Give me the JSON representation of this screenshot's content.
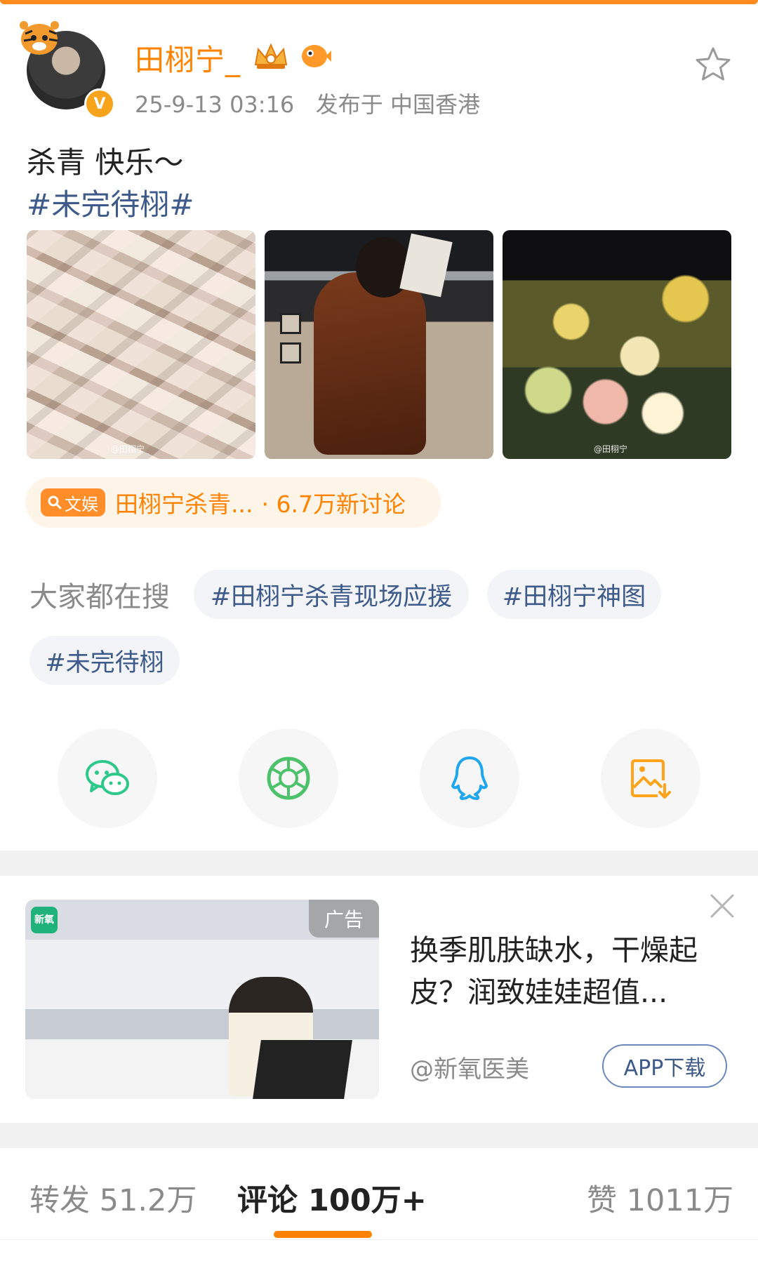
{
  "post": {
    "username": "田栩宁_",
    "timestamp": "25-9-13 03:16",
    "location": "发布于 中国香港",
    "text": "杀青  快乐～",
    "hashtag": "#未完待栩#",
    "photo_watermark_1": "@田栩宁_",
    "photo_watermark_3": "@田栩宁"
  },
  "topic": {
    "badge": "文娱",
    "title": "田栩宁杀青...",
    "count": "· 6.7万新讨论"
  },
  "search": {
    "label": "大家都在搜",
    "chips": [
      "#田栩宁杀青现场应援",
      "#田栩宁神图",
      "#未完待栩"
    ]
  },
  "share": {
    "icons": [
      "wechat-icon",
      "moments-icon",
      "qq-icon",
      "save-image-icon"
    ]
  },
  "ad": {
    "logo": "新氧",
    "tag": "广告",
    "title": "换季肌肤缺水，干燥起皮？润致娃娃超值...",
    "source": "@新氧医美",
    "button": "APP下载"
  },
  "tabs": {
    "repost": "转发 51.2万",
    "comment": "评论 100万+",
    "like": "赞 1011万"
  },
  "colors": {
    "brand": "#ff8200",
    "link": "#3d5a8a",
    "muted": "#8a8a8a"
  }
}
